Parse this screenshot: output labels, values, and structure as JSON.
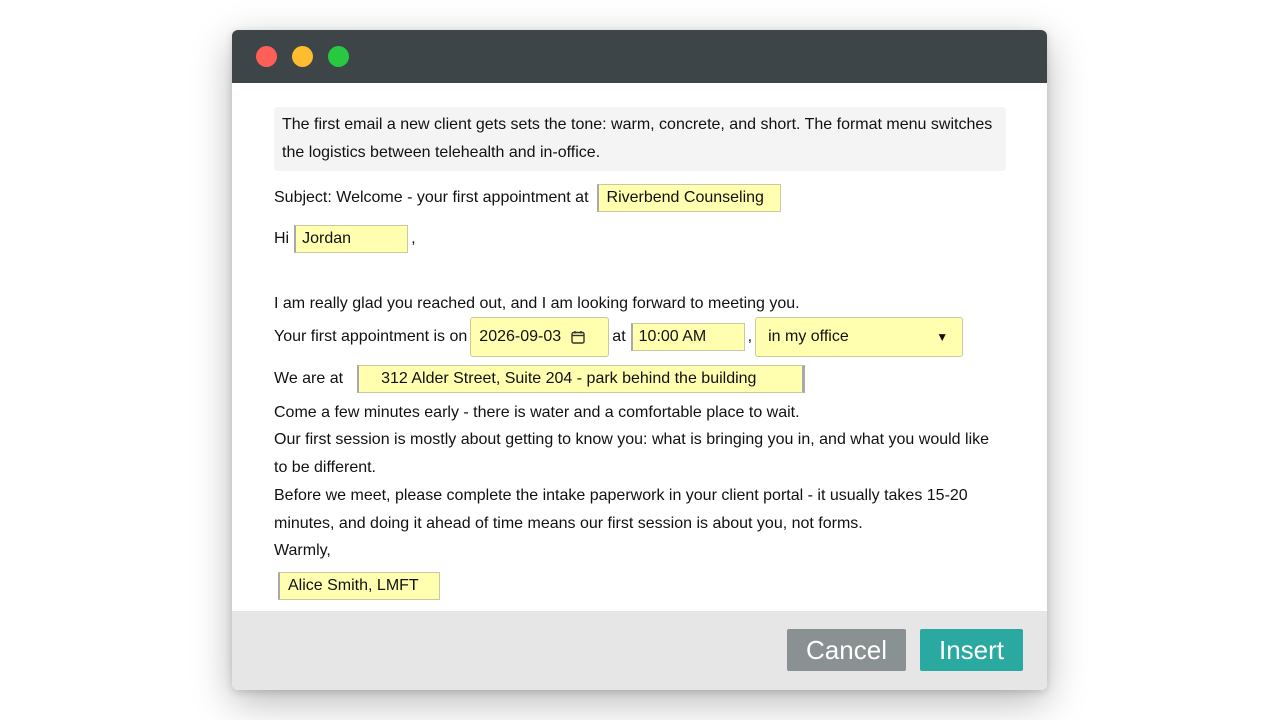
{
  "colors": {
    "titlebar": "#3d4548",
    "field_fill": "#ffffaf",
    "cancel_button": "#8a9192",
    "insert_button": "#2aa9a0",
    "footer": "#e6e6e6"
  },
  "note": "The first email a new client gets sets the tone: warm, concrete, and short. The format menu switches the logistics between telehealth and in-office.",
  "subject": {
    "prefix": "Subject: Welcome - your first appointment at",
    "practice_name": "Riverbend Counseling"
  },
  "greeting": {
    "prefix": "Hi",
    "client_name": "Jordan",
    "suffix": ","
  },
  "line_glad": "I am really glad you reached out, and I am looking forward to meeting you.",
  "appointment": {
    "prefix": "Your first appointment is on",
    "date": "2026-09-03",
    "at": "at",
    "time": "10:00 AM",
    "comma": ",",
    "format_selected": "in my office",
    "calendar_icon": "calendar-icon",
    "dropdown_icon": "caret-down-icon"
  },
  "location": {
    "prefix": "We are at",
    "address": "312 Alder Street, Suite 204 - park behind the building"
  },
  "line_early": "Come a few minutes early - there is water and a comfortable place to wait.",
  "line_session": "Our first session is mostly about getting to know you: what is bringing you in, and what you would like to be different.",
  "line_paperwork": "Before we meet, please complete the intake paperwork in your client portal - it usually takes 15-20 minutes, and doing it ahead of time means our first session is about you, not forms.",
  "signoff": "Warmly,",
  "signature": "Alice Smith, LMFT",
  "buttons": {
    "cancel": "Cancel",
    "insert": "Insert"
  }
}
